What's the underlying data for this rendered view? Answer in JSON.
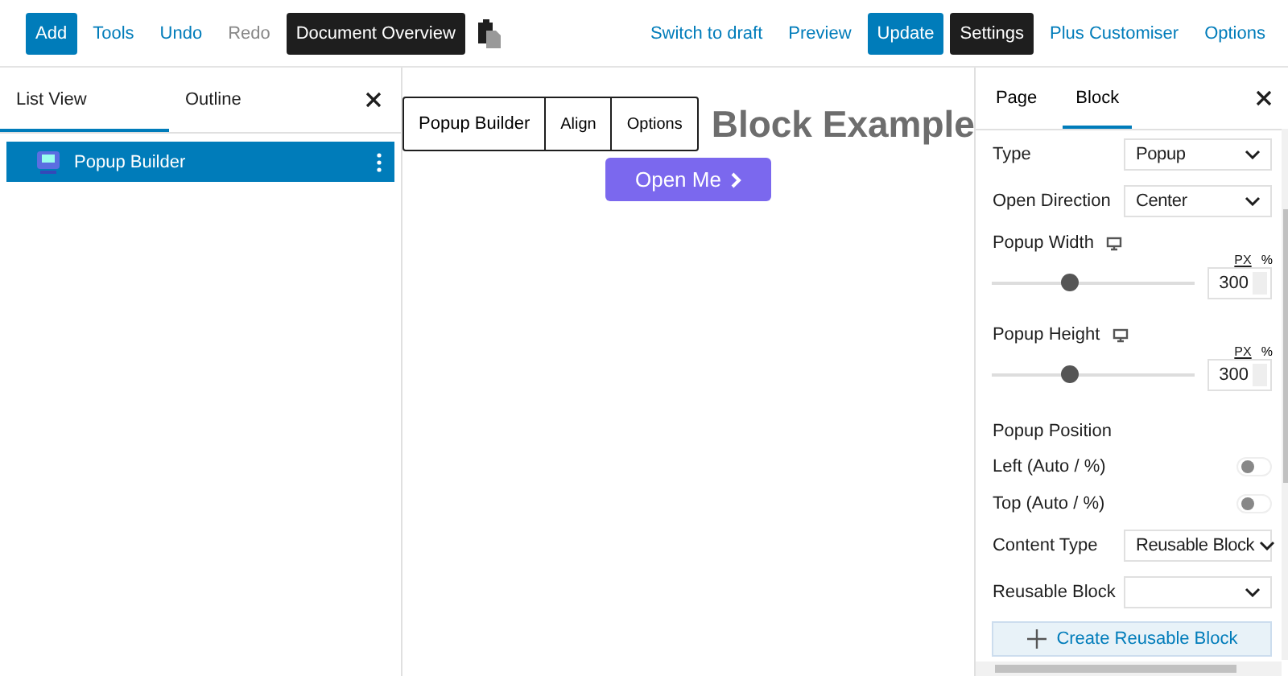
{
  "toolbar": {
    "left": [
      {
        "label": "Add",
        "kind": "primary"
      },
      {
        "label": "Tools",
        "kind": "link"
      },
      {
        "label": "Undo",
        "kind": "link"
      },
      {
        "label": "Redo",
        "kind": "muted"
      },
      {
        "label": "Document Overview",
        "kind": "dark"
      }
    ],
    "right": [
      {
        "label": "Switch to draft",
        "kind": "link"
      },
      {
        "label": "Preview",
        "kind": "link"
      },
      {
        "label": "Update",
        "kind": "primary"
      },
      {
        "label": "Settings",
        "kind": "dark"
      },
      {
        "label": "Plus Customiser",
        "kind": "link"
      },
      {
        "label": "Options",
        "kind": "link"
      }
    ]
  },
  "left_panel": {
    "tabs": [
      {
        "label": "List View",
        "selected": true
      },
      {
        "label": "Outline",
        "selected": false
      }
    ],
    "items": [
      {
        "label": "Popup Builder",
        "selected": true
      }
    ]
  },
  "canvas": {
    "block_toolbar": [
      "Popup Builder",
      "Align",
      "Options"
    ],
    "heading": "Block Example",
    "button": "Open Me"
  },
  "right_panel": {
    "tabs": [
      {
        "label": "Page",
        "selected": false
      },
      {
        "label": "Block",
        "selected": true
      }
    ],
    "rows": [
      {
        "kind": "select",
        "label": "Type",
        "value": "Popup"
      },
      {
        "kind": "select",
        "label": "Open Direction",
        "value": "Center"
      },
      {
        "kind": "slider",
        "label": "Popup Width",
        "units": [
          {
            "label": "PX",
            "selected": true
          },
          {
            "label": "%",
            "selected": false
          }
        ],
        "level": 0.38,
        "value": "300"
      },
      {
        "kind": "slider",
        "label": "Popup Height",
        "units": [
          {
            "label": "PX",
            "selected": true
          },
          {
            "label": "%",
            "selected": false
          }
        ],
        "level": 0.38,
        "value": "300"
      },
      {
        "kind": "heading",
        "label": "Popup Position"
      },
      {
        "kind": "toggle",
        "label": "Left (Auto / %)",
        "on": false
      },
      {
        "kind": "toggle",
        "label": "Top (Auto / %)",
        "on": false
      },
      {
        "kind": "select",
        "label": "Content Type",
        "value": "Reusable Block"
      },
      {
        "kind": "select",
        "label": "Reusable Block"
      },
      {
        "kind": "create",
        "label": "Create Reusable Block"
      }
    ]
  }
}
